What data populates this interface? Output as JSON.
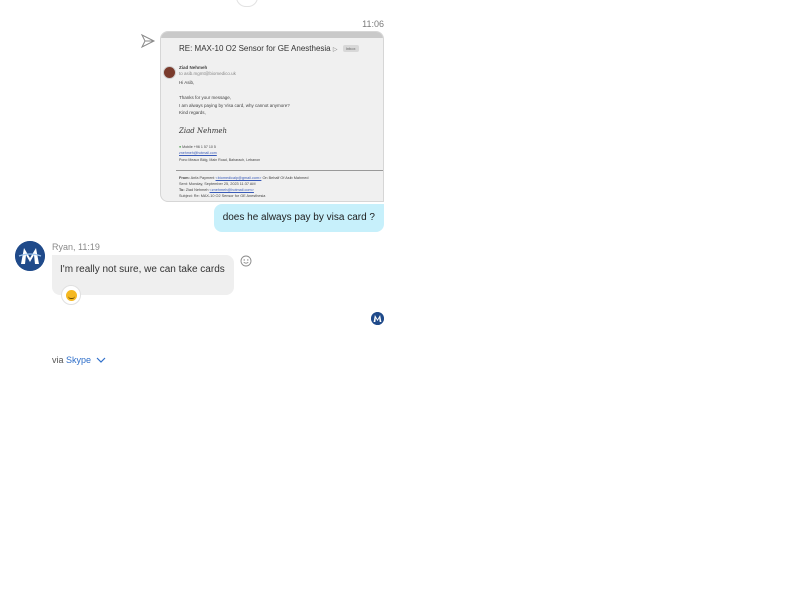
{
  "outgoing": {
    "timestamp": "11:06",
    "email_screenshot": {
      "subject": "RE: MAX-10 O2 Sensor for GE Anesthesia",
      "subject_tag": "Inbox",
      "from_name": "Ziad Nehmeh",
      "to_line": "to asib.mgmt@biomedico.uk",
      "greeting": "Hi Asib,",
      "body_line1": "Thanks for your message,",
      "body_line2": "I am always paying by Visa card, why cannot anymore?",
      "body_line3": "Kind regards,",
      "signature": "Ziad Nehmeh",
      "contact_phone": "Mobile +96 1 57 10 5",
      "contact_email": "znehmeh@hotmail.com",
      "contact_address": "Pono Meaux Bldg, Main Road, Baharach, Lebanon",
      "header_from_label": "From:",
      "header_from_value": "Anfa Payment",
      "header_from_email": "<biomedicalp@gmail.com>",
      "header_from_suffix": "On Behalf Of Asib Mahmed",
      "header_sent": "Sent: Monday, September 25, 2023 11:37 AM",
      "header_to_label": "To:",
      "header_to_value": "Ziad Nehmeh",
      "header_to_email": "<znehmeh@hotmail.com>",
      "header_subject": "Subject: Re: MAX-10 O2 Sensor for GE Anesthesia"
    },
    "message_text": "does he always pay by visa card ?"
  },
  "incoming": {
    "sender_line": "Ryan, 11:19",
    "message_text": "I'm really not sure, we can take cards",
    "reaction_icon": "laughing-emoji-icon"
  },
  "footer": {
    "via_prefix": "via",
    "via_link": "Skype"
  },
  "colors": {
    "outgoing_bubble": "#c7f0fb",
    "incoming_bubble": "#efefef",
    "link": "#2f6fca",
    "avatar": "#1f4a8a"
  }
}
